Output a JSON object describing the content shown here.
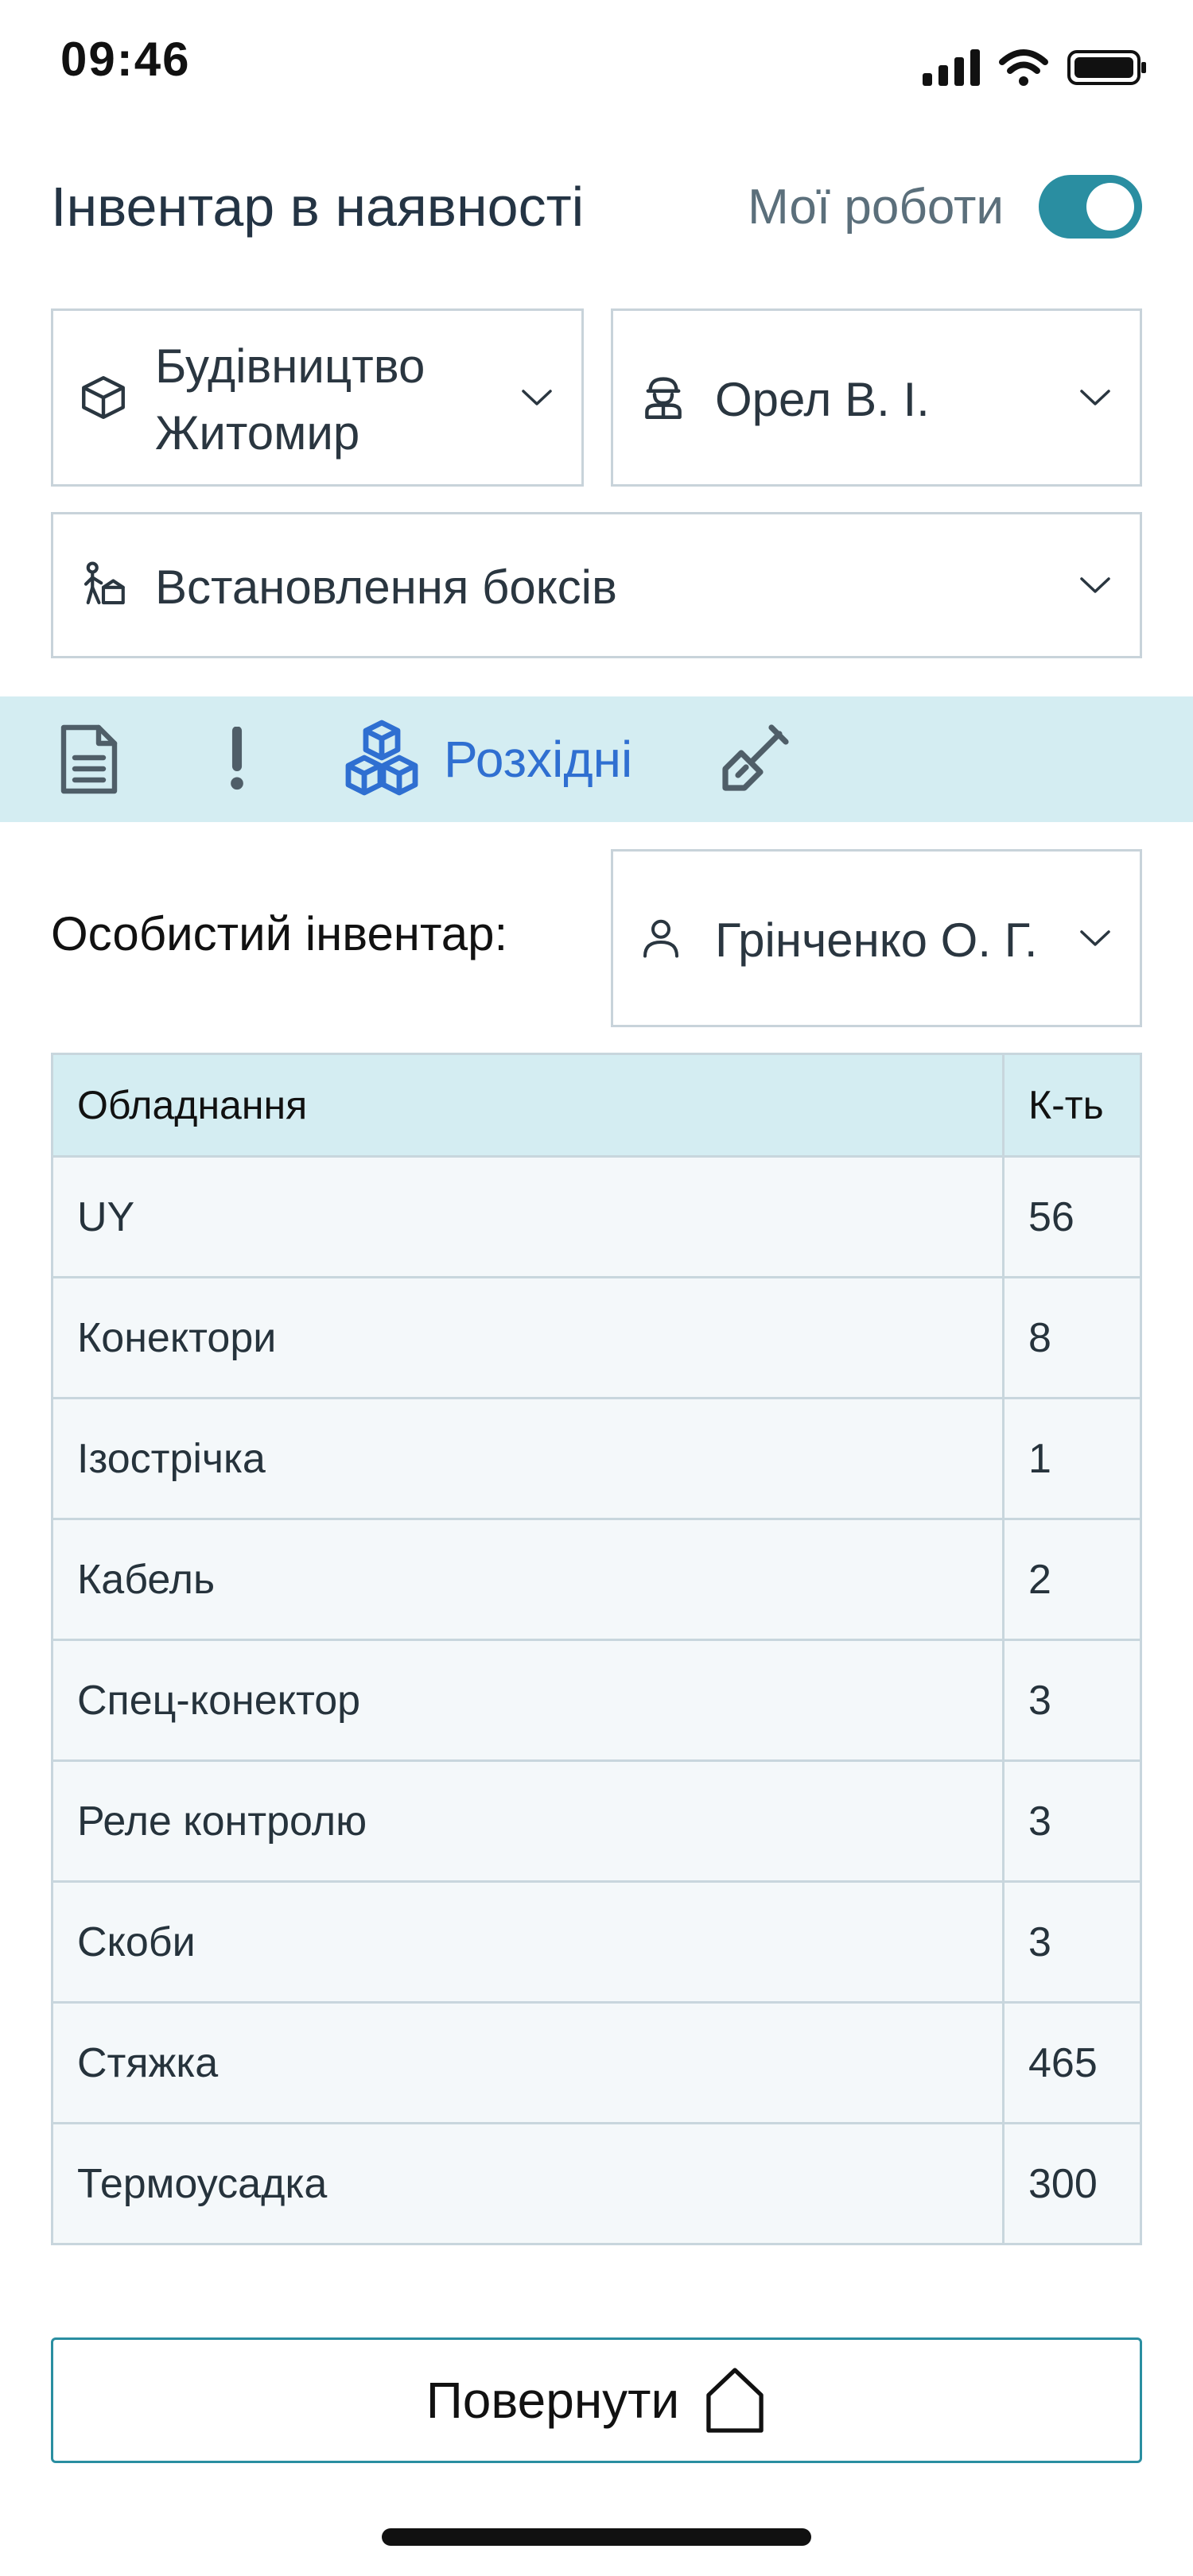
{
  "status_bar": {
    "time": "09:46",
    "icons": [
      "signal-icon",
      "wifi-icon",
      "battery-icon"
    ]
  },
  "header": {
    "title": "Інвентар в наявності",
    "toggle_label": "Мої роботи",
    "toggle_on": true,
    "accent_color": "#2a8ea1"
  },
  "filters": {
    "project": {
      "icon": "box-icon",
      "line1": "Будівництво",
      "line2": "Житомир"
    },
    "worker": {
      "icon": "worker-icon",
      "label": "Орел В. І."
    },
    "task": {
      "icon": "installer-icon",
      "label": "Встановлення боксів"
    }
  },
  "tabs": {
    "items": [
      {
        "icon": "document-icon",
        "active": false
      },
      {
        "icon": "exclamation-icon",
        "active": false
      },
      {
        "icon": "cubes-icon",
        "label": "Розхідні",
        "active": true
      },
      {
        "icon": "shovel-icon",
        "active": false
      }
    ],
    "active_color": "#2f6fd1"
  },
  "personal": {
    "label": "Особистий інвентар:",
    "person": {
      "icon": "person-icon",
      "label": "Грінченко О. Г."
    }
  },
  "table": {
    "headers": [
      "Обладнання",
      "К-ть"
    ],
    "rows": [
      [
        "UY",
        "56"
      ],
      [
        "Конектори",
        "8"
      ],
      [
        "Ізострічка",
        "1"
      ],
      [
        "Кабель",
        "2"
      ],
      [
        "Спец-конектор",
        "3"
      ],
      [
        "Реле контролю",
        "3"
      ],
      [
        "Скоби",
        "3"
      ],
      [
        "Стяжка",
        "465"
      ],
      [
        "Термоусадка",
        "300"
      ]
    ]
  },
  "footer": {
    "return_label": "Повернути",
    "return_icon": "home-icon"
  }
}
